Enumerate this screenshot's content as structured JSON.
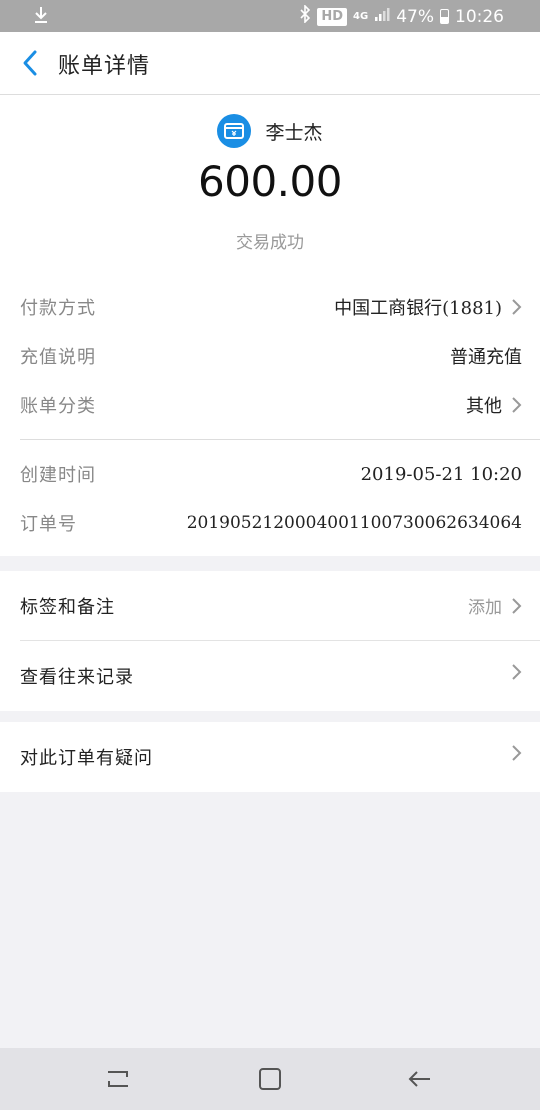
{
  "status_bar": {
    "network": "4G",
    "hd": "HD",
    "battery": "47%",
    "battery_level": 0.47,
    "time": "10:26"
  },
  "header": {
    "title": "账单详情"
  },
  "payee": {
    "name": "李士杰"
  },
  "amount": "600.00",
  "status": "交易成功",
  "details": [
    {
      "label": "付款方式",
      "value": "中国工商银行(1881)"
    },
    {
      "label": "充值说明",
      "value": "普通充值"
    },
    {
      "label": "账单分类",
      "value": "其他"
    },
    {
      "label": "创建时间",
      "value": "2019-05-21 10:20"
    },
    {
      "label": "订单号",
      "value": "2019052120004001100730062634064"
    }
  ],
  "actions": [
    {
      "label": "标签和备注",
      "value": "添加"
    },
    {
      "label": "查看往来记录",
      "value": ""
    },
    {
      "label": "对此订单有疑问",
      "value": ""
    }
  ],
  "colors": {
    "accent": "#1a8ee4",
    "status_bar": "#a8a8a8",
    "nav_bar": "#e2e2e6"
  }
}
